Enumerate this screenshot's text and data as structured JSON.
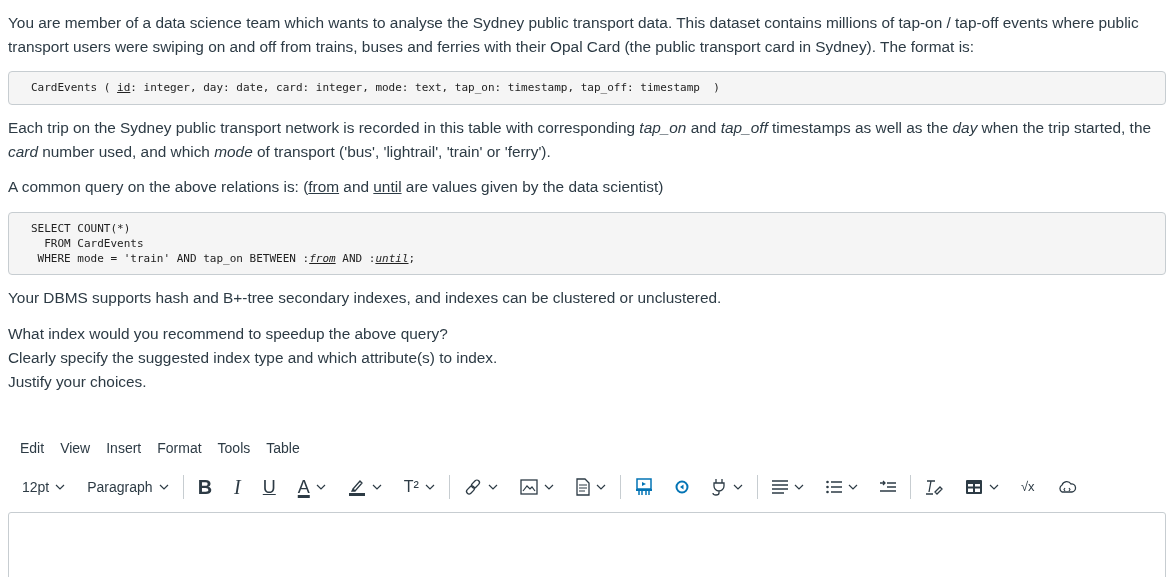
{
  "intro": "You are member of a data science team which wants to analyse the Sydney public transport data. This dataset contains millions of tap-on / tap-off events where public transport users were swiping on and off from trains, buses and ferries with their Opal Card (the public transport card in Sydney). The format is:",
  "schema": {
    "lines": [
      [
        {
          "text": "CardEvents ( ",
          "underline": false
        },
        {
          "text": "id",
          "underline": true
        },
        {
          "text": ": integer, day: date, card: integer, mode: text, tap_on: timestamp, tap_off: timestamp  )",
          "underline": false
        }
      ]
    ]
  },
  "description": "Each trip on the Sydney public transport network is recorded in this table with corresponding *tap_on* and *tap_off* timestamps as well as the *day* when the trip started, the *card* number used, and which *mode* of transport ('bus', 'lightrail', 'train' or 'ferry').",
  "query_intro": [
    {
      "text": "A common query on the above relations is:   (",
      "underline": false
    },
    {
      "text": "from",
      "underline": true
    },
    {
      "text": " and ",
      "underline": false
    },
    {
      "text": "until",
      "underline": true
    },
    {
      "text": " are values given by the data scientist)",
      "underline": false
    }
  ],
  "query": {
    "lines": [
      [
        {
          "text": "SELECT COUNT(*)",
          "underline": false,
          "italic": false
        }
      ],
      [
        {
          "text": "  FROM CardEvents",
          "underline": false,
          "italic": false
        }
      ],
      [
        {
          "text": " WHERE mode = 'train' AND tap_on BETWEEN :",
          "underline": false,
          "italic": false
        },
        {
          "text": "from",
          "underline": true,
          "italic": true
        },
        {
          "text": " AND :",
          "underline": false,
          "italic": false
        },
        {
          "text": "until",
          "underline": true,
          "italic": true
        },
        {
          "text": ";",
          "underline": false,
          "italic": false
        }
      ]
    ]
  },
  "dbms": "Your DBMS supports hash and B+-tree secondary indexes, and indexes can be clustered or unclustered.",
  "question": [
    "What index would you recommend to speedup the above query?",
    "Clearly specify the suggested index type and which attribute(s) to index.",
    "Justify your choices."
  ],
  "editor": {
    "menu": [
      "Edit",
      "View",
      "Insert",
      "Format",
      "Tools",
      "Table"
    ],
    "toolbar": [
      [
        {
          "kind": "text",
          "label": "12pt",
          "dropdown": true
        },
        {
          "kind": "text",
          "label": "Paragraph",
          "dropdown": true
        }
      ],
      [
        {
          "kind": "bold",
          "label": "B",
          "dropdown": false
        },
        {
          "kind": "italic",
          "label": "I",
          "dropdown": false
        },
        {
          "kind": "underline",
          "label": "U",
          "dropdown": false
        },
        {
          "kind": "textcolor",
          "label": "A",
          "dropdown": true
        },
        {
          "kind": "highlight",
          "dropdown": true
        },
        {
          "kind": "superscript",
          "label": "T²",
          "dropdown": true
        }
      ],
      [
        {
          "kind": "link",
          "dropdown": true
        },
        {
          "kind": "image",
          "dropdown": true
        },
        {
          "kind": "document",
          "dropdown": true
        }
      ],
      [
        {
          "kind": "media",
          "dropdown": false
        },
        {
          "kind": "record",
          "dropdown": false
        },
        {
          "kind": "plugin",
          "dropdown": true
        }
      ],
      [
        {
          "kind": "align",
          "dropdown": true
        },
        {
          "kind": "list",
          "dropdown": true
        },
        {
          "kind": "indent",
          "dropdown": false
        }
      ],
      [
        {
          "kind": "clearformat",
          "dropdown": false
        },
        {
          "kind": "table",
          "dropdown": true
        },
        {
          "kind": "math",
          "label": "√x",
          "dropdown": false
        },
        {
          "kind": "cloud",
          "dropdown": false
        }
      ]
    ]
  }
}
